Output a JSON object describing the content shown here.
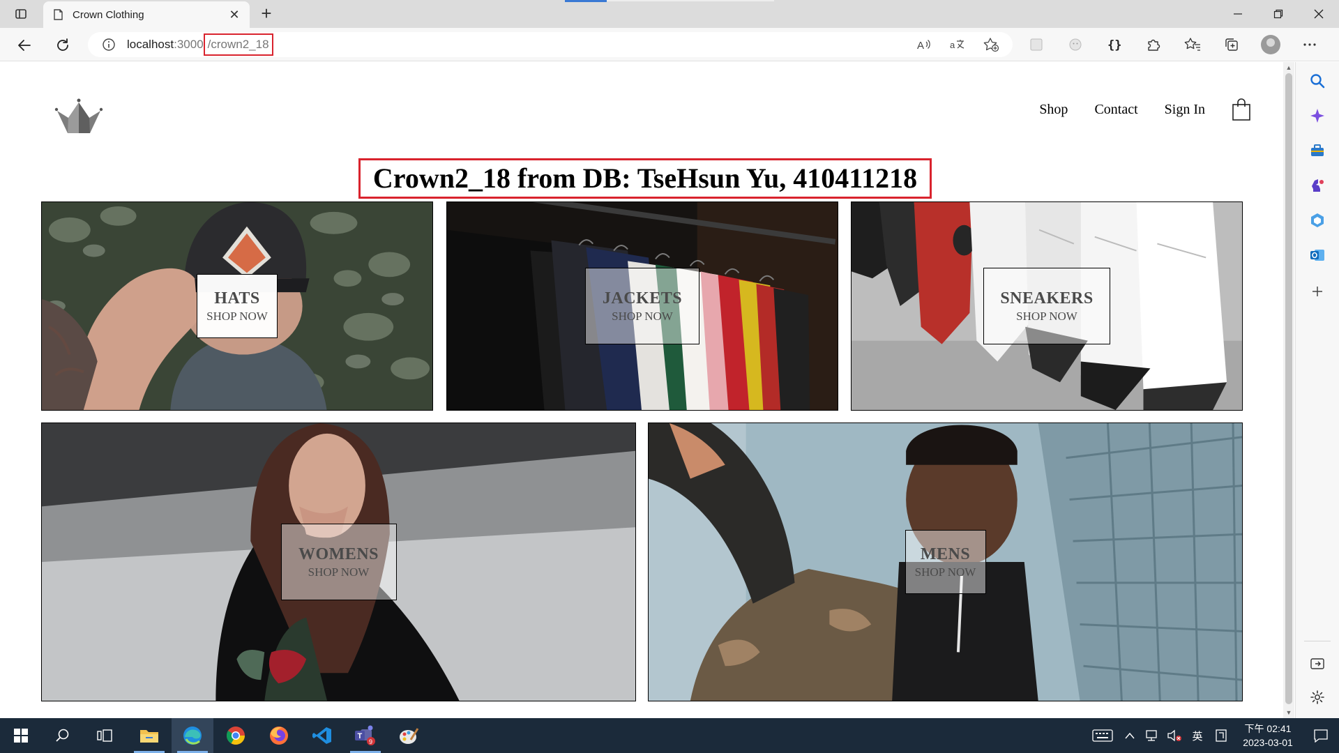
{
  "browser": {
    "tab_title": "Crown Clothing",
    "new_tab_glyph": "+",
    "close_glyph": "✕",
    "url_host": "localhost",
    "url_port": ":3000",
    "url_path": "/crown2_18"
  },
  "site": {
    "nav": {
      "shop": "Shop",
      "contact": "Contact",
      "sign_in": "Sign In"
    },
    "heading": "Crown2_18 from DB: TseHsun Yu, 410411218",
    "categories": [
      {
        "title": "HATS",
        "subtitle": "SHOP NOW"
      },
      {
        "title": "JACKETS",
        "subtitle": "SHOP NOW"
      },
      {
        "title": "SNEAKERS",
        "subtitle": "SHOP NOW"
      },
      {
        "title": "WOMENS",
        "subtitle": "SHOP NOW"
      },
      {
        "title": "MENS",
        "subtitle": "SHOP NOW"
      }
    ]
  },
  "taskbar": {
    "ime_label": "英",
    "clock_line1": "下午 02:41",
    "clock_line2": "2023-03-01",
    "teams_badge": "9"
  },
  "colors": {
    "highlight_red": "#d9232d",
    "taskbar_bg": "#1b2a3a"
  }
}
